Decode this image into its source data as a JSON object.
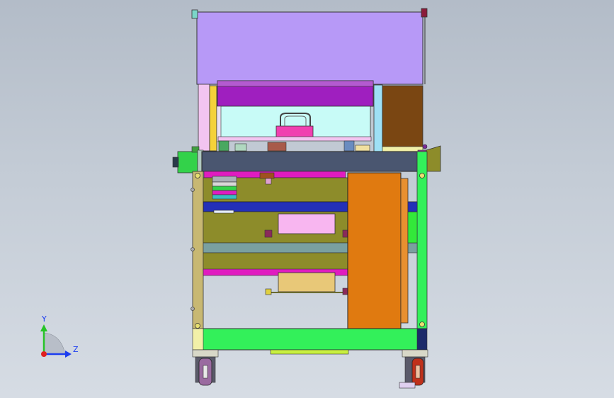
{
  "viewport": {
    "background_top": "#b3bcc8",
    "background_bottom": "#d6dce4"
  },
  "triad": {
    "y_label": "Y",
    "z_label": "Z",
    "y_color": "#27c427",
    "z_color": "#1c3df0",
    "origin_color": "#e02020"
  },
  "model": {
    "description_icon": "cad-assembly-front-view",
    "colors": {
      "top_cover": "#b799f7",
      "top_slide": "#9f1fbf",
      "window": "#c8fbf7",
      "brown_panel": "#7a4612",
      "beam": "#4a5670",
      "frame_green": "#33f05a",
      "frame_olive": "#8d8c2a",
      "blue_bar": "#2330b8",
      "orange_door": "#e07a10",
      "pink_box": "#f8b6f0",
      "tan_box": "#e8c878",
      "magenta": "#e01cc0",
      "frame_tan": "#c8b872",
      "wheel_red": "#c0301a"
    }
  }
}
